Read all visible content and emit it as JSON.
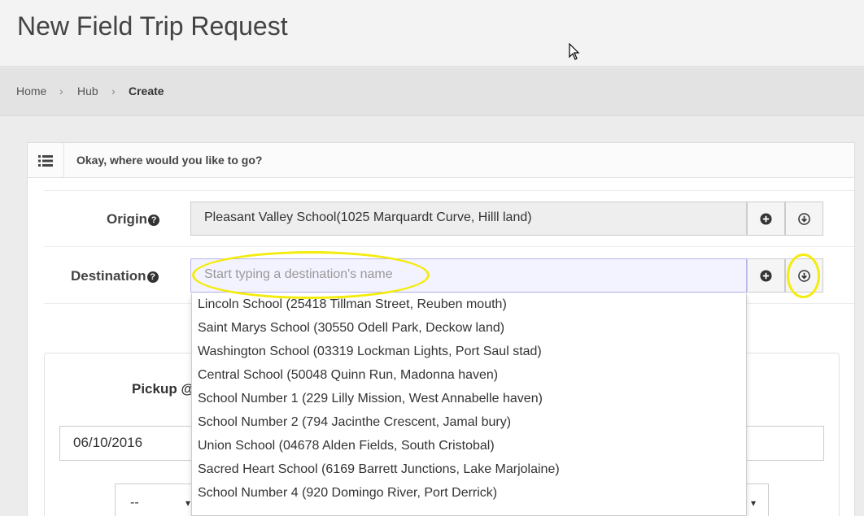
{
  "page": {
    "title": "New Field Trip Request"
  },
  "breadcrumb": {
    "home": "Home",
    "hub": "Hub",
    "current": "Create",
    "separator": "›"
  },
  "card": {
    "title": "Okay, where would you like to go?",
    "icon": "list-icon"
  },
  "origin": {
    "label": "Origin",
    "value": "Pleasant Valley School(1025 Marquardt Curve, Hilll land)"
  },
  "destination": {
    "label": "Destination",
    "placeholder": "Start typing a destination's name"
  },
  "help_glyph": "?",
  "pickup": {
    "label": "Pickup @",
    "date": "06/10/2016",
    "select_value": "--",
    "arrow": "▾"
  },
  "dropdown": {
    "items": [
      "Lincoln School (25418 Tillman Street, Reuben mouth)",
      "Saint Marys School (30550 Odell Park, Deckow land)",
      "Washington School (03319 Lockman Lights, Port Saul stad)",
      "Central School (50048 Quinn Run, Madonna haven)",
      "School Number 1 (229 Lilly Mission, West Annabelle haven)",
      "School Number 2 (794 Jacinthe Crescent, Jamal bury)",
      "Union School (04678 Alden Fields, South Cristobal)",
      "Sacred Heart School (6169 Barrett Junctions, Lake Marjolaine)",
      "School Number 4 (920 Domingo River, Port Derrick)"
    ]
  },
  "colors": {
    "highlight": "#f4ec0a",
    "dest_bg": "#f3f2ff"
  }
}
